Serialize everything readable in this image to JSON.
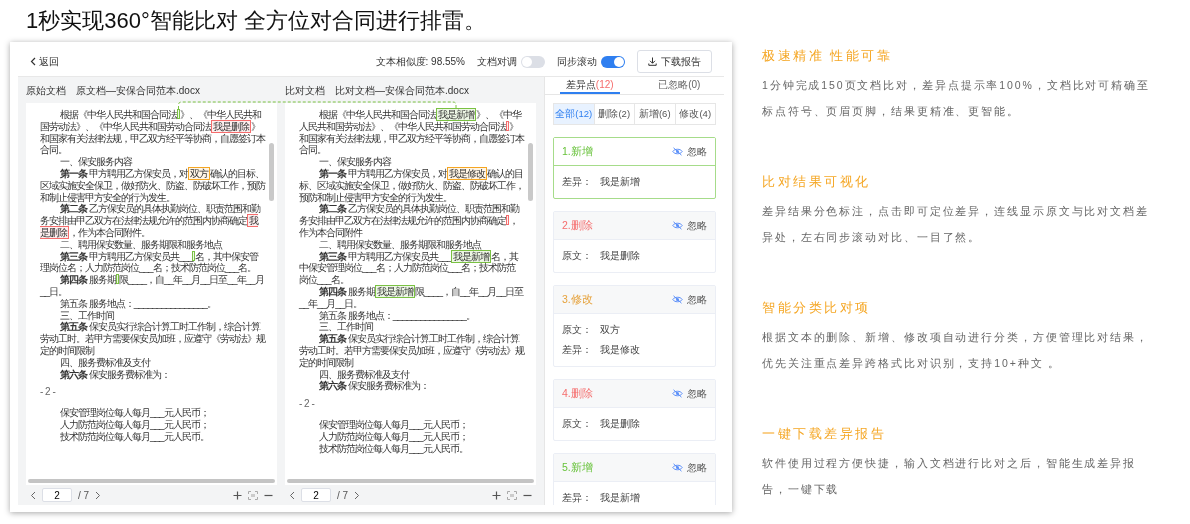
{
  "headline": "1秒实现360°智能比对 全方位对合同进行排雷。",
  "app": {
    "toolbar": {
      "back": "返回",
      "similarity": "文本相似度: 98.55%",
      "toggles": [
        {
          "label": "文档对调",
          "on": false
        },
        {
          "label": "同步滚动",
          "on": true
        }
      ],
      "download": "下载报告"
    },
    "documents": [
      {
        "label": "原始文档",
        "file": "原文档—安保合同范本.docx",
        "page": "2",
        "total": "/ 7",
        "paragraphs": [
          {
            "kind": "text",
            "runs": [
              {
                "kind": "text",
                "text": "根据《中华人民共和国合同法"
              },
              {
                "kind": "added"
              },
              {
                "kind": "text",
                "text": "》、《中华人民共和国劳动法》、《中华人民共和国劳动合同法"
              },
              {
                "kind": "deleted",
                "text": "我是删除"
              },
              {
                "kind": "text",
                "text": "》和国家有关法律法规，甲乙双方经平等协商，自愿签订本合同。"
              }
            ]
          },
          {
            "kind": "text",
            "runs": [
              {
                "kind": "text",
                "text": "一、保安服务内容"
              }
            ]
          },
          {
            "kind": "text",
            "runs": [
              {
                "kind": "text",
                "text": "**第一条** 甲方聘用乙方保安员，对"
              },
              {
                "kind": "modified",
                "text": "双方"
              },
              {
                "kind": "text",
                "text": "确认的目标、区域实施安全保卫，做好防火、防盗、防破坏工作，预防和制止侵害甲方安全的行为发生。"
              }
            ]
          },
          {
            "kind": "text",
            "runs": [
              {
                "kind": "text",
                "text": "**第二条** 乙方保安员的具体执勤岗位、职责范围和勤务安排由甲乙双方在法律法规允许的范围内协商确定"
              },
              {
                "kind": "deleted",
                "text": "我是删除"
              },
              {
                "kind": "text",
                "text": "，作为本合同附件。"
              }
            ]
          },
          {
            "kind": "text",
            "runs": [
              {
                "kind": "text",
                "text": "二、聘用保安数量、服务期限和服务地点"
              }
            ]
          },
          {
            "kind": "text",
            "runs": [
              {
                "kind": "text",
                "text": "**第三条** 甲方聘用乙方保安员共___"
              },
              {
                "kind": "added"
              },
              {
                "kind": "text",
                "text": "名，其中保安管理岗位名；人力防范岗位___名；技术防范岗位___名。"
              }
            ]
          },
          {
            "kind": "text",
            "runs": [
              {
                "kind": "text",
                "text": "**第四条** 服务期"
              },
              {
                "kind": "added"
              },
              {
                "kind": "text",
                "text": "限____，自__年__月__日至__年__月__日。"
              }
            ]
          },
          {
            "kind": "text",
            "runs": [
              {
                "kind": "text",
                "text": "第五条 服务地点：________________。"
              }
            ]
          },
          {
            "kind": "text",
            "runs": [
              {
                "kind": "text",
                "text": "三、工作时间"
              }
            ]
          },
          {
            "kind": "text",
            "runs": [
              {
                "kind": "text",
                "text": "**第五条** 保安员实行综合计算工时工作制，综合计算劳动工时。若甲方需要保安员加班，应遵守《劳动法》规定的时间限制"
              }
            ]
          },
          {
            "kind": "text",
            "runs": [
              {
                "kind": "text",
                "text": "四、服务费标准及支付"
              }
            ]
          },
          {
            "kind": "text",
            "runs": [
              {
                "kind": "text",
                "text": "**第六条** 保安服务费标准为："
              }
            ]
          },
          {
            "kind": "page_number",
            "text": "- 2 -"
          },
          {
            "kind": "text",
            "runs": [
              {
                "kind": "text",
                "text": "保安管理岗位每人每月___元人民币；"
              }
            ]
          },
          {
            "kind": "text",
            "runs": [
              {
                "kind": "text",
                "text": "人力防范岗位每人每月___元人民币；"
              }
            ]
          },
          {
            "kind": "text",
            "runs": [
              {
                "kind": "text",
                "text": "技术防范岗位每人每月___元人民币。"
              }
            ]
          }
        ]
      },
      {
        "label": "比对文档",
        "file": "比对文档—安保合同范本.docx",
        "page": "2",
        "total": "/ 7",
        "paragraphs": [
          {
            "kind": "text",
            "runs": [
              {
                "kind": "text",
                "text": "根据《中华人民共和国合同法"
              },
              {
                "kind": "added",
                "text": "我是新增"
              },
              {
                "kind": "text",
                "text": "》、《中华人民共和国劳动法》、《中华人民共和国劳动合同法"
              },
              {
                "kind": "deleted"
              },
              {
                "kind": "text",
                "text": "》和国家有关法律法规，甲乙双方经平等协商，自愿签订本合同。"
              }
            ]
          },
          {
            "kind": "text",
            "runs": [
              {
                "kind": "text",
                "text": "一、保安服务内容"
              }
            ]
          },
          {
            "kind": "text",
            "runs": [
              {
                "kind": "text",
                "text": "**第一条** 甲方聘用乙方保安员，对"
              },
              {
                "kind": "modified",
                "text": "我是修改"
              },
              {
                "kind": "text",
                "text": "确认的目标、区域实施安全保卫，做好防火、防盗、防破坏工作，预防和制止侵害甲方安全的行为发生。"
              }
            ]
          },
          {
            "kind": "text",
            "runs": [
              {
                "kind": "text",
                "text": "**第二条** 乙方保安员的具体执勤岗位、职责范围和勤务安排由甲乙双方在法律法规允许的范围内协商确定"
              },
              {
                "kind": "deleted"
              },
              {
                "kind": "text",
                "text": "，作为本合同附件"
              }
            ]
          },
          {
            "kind": "text",
            "runs": [
              {
                "kind": "text",
                "text": "二、聘用保安数量、服务期限和服务地点"
              }
            ]
          },
          {
            "kind": "text",
            "runs": [
              {
                "kind": "text",
                "text": "**第三条** 甲方聘用乙方保安员共___"
              },
              {
                "kind": "added",
                "text": "我是新增"
              },
              {
                "kind": "text",
                "text": "名，其中保安管理岗位___名；人力防范岗位___名；技术防范岗位___名。"
              }
            ]
          },
          {
            "kind": "text",
            "runs": [
              {
                "kind": "text",
                "text": "**第四条** 服务期"
              },
              {
                "kind": "added",
                "text": "我是新增"
              },
              {
                "kind": "text",
                "text": "限____，自__年__月__日至__年__月__日。"
              }
            ]
          },
          {
            "kind": "text",
            "runs": [
              {
                "kind": "text",
                "text": "第五条 服务地点：________________。"
              }
            ]
          },
          {
            "kind": "text",
            "runs": [
              {
                "kind": "text",
                "text": "三、工作时间"
              }
            ]
          },
          {
            "kind": "text",
            "runs": [
              {
                "kind": "text",
                "text": "**第五条** 保安员实行综合计算工时工作制，综合计算劳动工时。若甲方需要保安员加班，应遵守《劳动法》规定的时间限制"
              }
            ]
          },
          {
            "kind": "text",
            "runs": [
              {
                "kind": "text",
                "text": "四、服务费标准及支付"
              }
            ]
          },
          {
            "kind": "text",
            "runs": [
              {
                "kind": "text",
                "text": "**第六条** 保安服务费标准为："
              }
            ]
          },
          {
            "kind": "page_number",
            "text": "- 2 -"
          },
          {
            "kind": "text",
            "runs": [
              {
                "kind": "text",
                "text": "保安管理岗位每人每月___元人民币；"
              }
            ]
          },
          {
            "kind": "text",
            "runs": [
              {
                "kind": "text",
                "text": "人力防范岗位每人每月___元人民币；"
              }
            ]
          },
          {
            "kind": "text",
            "runs": [
              {
                "kind": "text",
                "text": "技术防范岗位每人每月___元人民币。"
              }
            ]
          }
        ]
      }
    ],
    "diff_panel": {
      "tabs": [
        {
          "label": "差异点",
          "count": "(12)",
          "selected": true
        },
        {
          "label": "已忽略",
          "count": "(0)",
          "selected": false
        }
      ],
      "filters": [
        {
          "label": "全部(12)",
          "selected": true
        },
        {
          "label": "删除(2)",
          "selected": false
        },
        {
          "label": "新增(6)",
          "selected": false
        },
        {
          "label": "修改(4)",
          "selected": false
        }
      ],
      "items": [
        {
          "title": "1.新增",
          "kind": "added",
          "selected": true,
          "ignore": "忽略",
          "rows": [
            {
              "label": "差异：",
              "value": "我是新增"
            }
          ]
        },
        {
          "title": "2.删除",
          "kind": "deleted",
          "selected": false,
          "ignore": "忽略",
          "rows": [
            {
              "label": "原文：",
              "value": "我是删除"
            }
          ]
        },
        {
          "title": "3.修改",
          "kind": "modified",
          "selected": false,
          "ignore": "忽略",
          "rows": [
            {
              "label": "原文：",
              "value": "双方"
            },
            {
              "label": "差异：",
              "value": "我是修改"
            }
          ]
        },
        {
          "title": "4.删除",
          "kind": "deleted",
          "selected": false,
          "ignore": "忽略",
          "rows": [
            {
              "label": "原文：",
              "value": "我是删除"
            }
          ]
        },
        {
          "title": "5.新增",
          "kind": "added",
          "selected": false,
          "ignore": "忽略",
          "rows": [
            {
              "label": "差异：",
              "value": "我是新增"
            }
          ]
        }
      ]
    }
  },
  "features": [
    {
      "title": "极速精准 性能可靠",
      "body": "1分钟完成150页文档比对，差异点提示率100%，文档比对可精确至标点符号、页眉页脚，结果更精准、更智能。"
    },
    {
      "title": "比对结果可视化",
      "body": "差异结果分色标注，点击即可定位差异，连线显示原文与比对文档差异处，左右同步滚动对比、一目了然。"
    },
    {
      "title": "智能分类比对项",
      "body": "根据文本的删除、新增、修改项自动进行分类，方便管理比对结果，优先关注重点差异跨格式比对识别，支持10+种文 。"
    },
    {
      "title": "一键下载差异报告",
      "body": "软件使用过程方便快捷，输入文档进行比对之后，智能生成差异报告，一键下载"
    }
  ]
}
